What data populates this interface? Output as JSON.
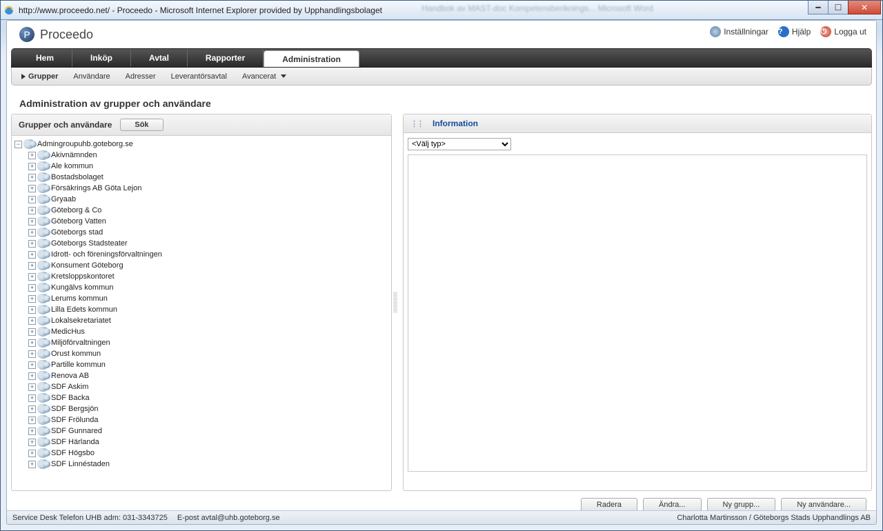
{
  "window": {
    "title": "http://www.proceedo.net/ - Proceedo - Microsoft Internet Explorer provided by Upphandlingsbolaget",
    "blurred_hint": "Handbok av MAST-doc Kompetensberiknings...   Microsoft Word"
  },
  "brand": {
    "name": "Proceedo"
  },
  "toplinks": {
    "settings": "Inställningar",
    "help": "Hjälp",
    "logout": "Logga ut"
  },
  "tabs": {
    "hem": "Hem",
    "inkop": "Inköp",
    "avtal": "Avtal",
    "rapporter": "Rapporter",
    "administration": "Administration"
  },
  "subtabs": {
    "grupper": "Grupper",
    "anvandare": "Användare",
    "adresser": "Adresser",
    "leverantorsavtal": "Leverantörsavtal",
    "avancerat": "Avancerat"
  },
  "page": {
    "title": "Administration av grupper och användare"
  },
  "left": {
    "header": "Grupper och användare",
    "search_btn": "Sök",
    "root": "Admingroupuhb.goteborg.se",
    "items": [
      "Akivnämnden",
      "Ale kommun",
      "Bostadsbolaget",
      "Försäkrings AB Göta Lejon",
      "Gryaab",
      "Göteborg & Co",
      "Göteborg Vatten",
      "Göteborgs stad",
      "Göteborgs Stadsteater",
      "Idrott- och föreningsförvaltningen",
      "Konsument Göteborg",
      "Kretsloppskontoret",
      "Kungälvs kommun",
      "Lerums kommun",
      "Lilla Edets kommun",
      "Lokalsekretariatet",
      "MedicHus",
      "Miljöförvaltningen",
      "Orust kommun",
      "Partille kommun",
      "Renova AB",
      "SDF Askim",
      "SDF Backa",
      "SDF Bergsjön",
      "SDF Frölunda",
      "SDF Gunnared",
      "SDF Härlanda",
      "SDF Högsbo",
      "SDF Linnéstaden"
    ]
  },
  "right": {
    "header": "Information",
    "select_placeholder": "<Välj typ>"
  },
  "actions": {
    "delete": "Radera",
    "edit": "Ändra...",
    "newgroup": "Ny grupp...",
    "newuser": "Ny användare..."
  },
  "footer": {
    "left1": "Service Desk Telefon UHB adm: 031-3343725",
    "left2": "E-post avtal@uhb.goteborg.se",
    "right": "Charlotta Martinsson / Göteborgs Stads Upphandlings AB"
  }
}
